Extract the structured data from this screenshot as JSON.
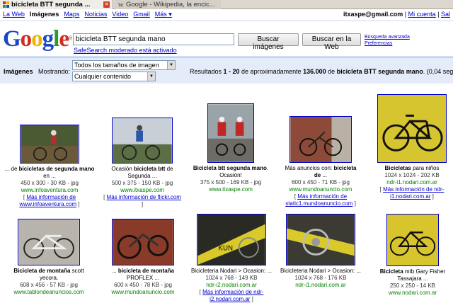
{
  "browser": {
    "tabs": [
      {
        "label": "bicicleta BTT segunda ...",
        "close": "×"
      },
      {
        "label": "Google - Wikipedia, la encic..."
      }
    ]
  },
  "gbar": {
    "links": [
      "La Web",
      "Imágenes",
      "Maps",
      "Noticias",
      "Video",
      "Gmail",
      "Más ▾"
    ],
    "user_email": "itxaspe@gmail.com",
    "my_account": "Mi cuenta",
    "sign_out": "Sal"
  },
  "search": {
    "logo_letters": [
      "G",
      "o",
      "o",
      "g",
      "l",
      "e"
    ],
    "query": "bicicleta BTT segunda mano",
    "btn_images": "Buscar imágenes",
    "btn_web": "Buscar en la Web",
    "advanced": "Búsqueda avanzada",
    "prefs": "Preferencias",
    "safesearch": "SafeSearch moderado está activado"
  },
  "results_bar": {
    "images_label": "Imágenes",
    "showing_label": "Mostrando:",
    "size_select": "Todos los tamaños de imagen",
    "content_select": "Cualquier contenido",
    "stats_prefix": "Resultados ",
    "range": "1 - 20",
    "stats_mid": " de aproximadamente ",
    "count": "136.000",
    "stats_for": " de ",
    "query_bold": "bicicleta BTT segunda mano",
    "time": ". (0,04 segundos"
  },
  "results": [
    {
      "cap_pre": "... de ",
      "cap_bold": "bicicletas de segunda mano",
      "cap_post": " en ...",
      "meta": "450 x 300 - 30 KB - jpg",
      "site": "www.infoaventura.com",
      "more_pre": "[ ",
      "more": "Más información de www.infoaventura.com",
      "more_post": " ]"
    },
    {
      "cap_pre": "Ocasión ",
      "cap_bold": "bicicleta btt",
      "cap_post": " de Segunda ...",
      "meta": "500 x 375 - 150 KB - jpg",
      "site": "www.itxaspe.com",
      "more_pre": "[ ",
      "more": "Más información de flickr.com",
      "more_post": " ]"
    },
    {
      "cap_pre": "",
      "cap_bold": "Bicicleta btt segunda mano",
      "cap_post": ". Ocasión!",
      "meta": "375 x 500 - 169 KB - jpg",
      "site": "www.itxaspe.com",
      "more_pre": "",
      "more": "",
      "more_post": ""
    },
    {
      "cap_pre": "Más anuncios con: ",
      "cap_bold": "bicicleta de",
      "cap_post": " ...",
      "meta": "600 x 450 - 71 KB - jpg",
      "site": "www.mundoanuncio.com",
      "more_pre": "[ ",
      "more": "Más información de static1.mundoanuncio.com",
      "more_post": " ]"
    },
    {
      "cap_pre": "",
      "cap_bold": "Bicicletas",
      "cap_post": " para niños",
      "meta": "1024 x 1024 - 202 KB",
      "site": "ndr-i1.nodari.com.ar",
      "more_pre": "[ ",
      "more": "Más información de ndr-i1.nodari.com.ar",
      "more_post": " ]"
    },
    {
      "cap_pre": "",
      "cap_bold": "Bicicleta de montaña",
      "cap_post": " scott yecora.",
      "meta": "608 x 456 - 57 KB - jpg",
      "site": "www.tablondeanuncios.com",
      "more_pre": "",
      "more": "",
      "more_post": ""
    },
    {
      "cap_pre": "... ",
      "cap_bold": "bicicleta de montaña",
      "cap_post": " PROFLEX ...",
      "meta": "600 x 450 - 78 KB - jpg",
      "site": "www.mundoanuncio.com",
      "more_pre": "",
      "more": "",
      "more_post": ""
    },
    {
      "cap_pre": "Bicicleteria Nodari > Ocasion: ...",
      "cap_bold": "",
      "cap_post": "",
      "meta": "1024 x 768 - 149 KB",
      "site": "ndr-i2.nodari.com.ar",
      "more_pre": "[ ",
      "more": "Más información de ndr-i2.nodari.com.ar",
      "more_post": " ]"
    },
    {
      "cap_pre": "Bicicleteria Nodari > Ocasion: ...",
      "cap_bold": "",
      "cap_post": "",
      "meta": "1024 x 768 - 176 KB",
      "site": "ndr-i1.nodari.com.ar",
      "more_pre": "",
      "more": "",
      "more_post": ""
    },
    {
      "cap_pre": "",
      "cap_bold": "Bicicleta",
      "cap_post": " mtb Gary Fisher Tassajara ...",
      "meta": "250 x 250 - 14 KB",
      "site": "www.nodari.com.ar",
      "more_pre": "",
      "more": "",
      "more_post": ""
    }
  ]
}
